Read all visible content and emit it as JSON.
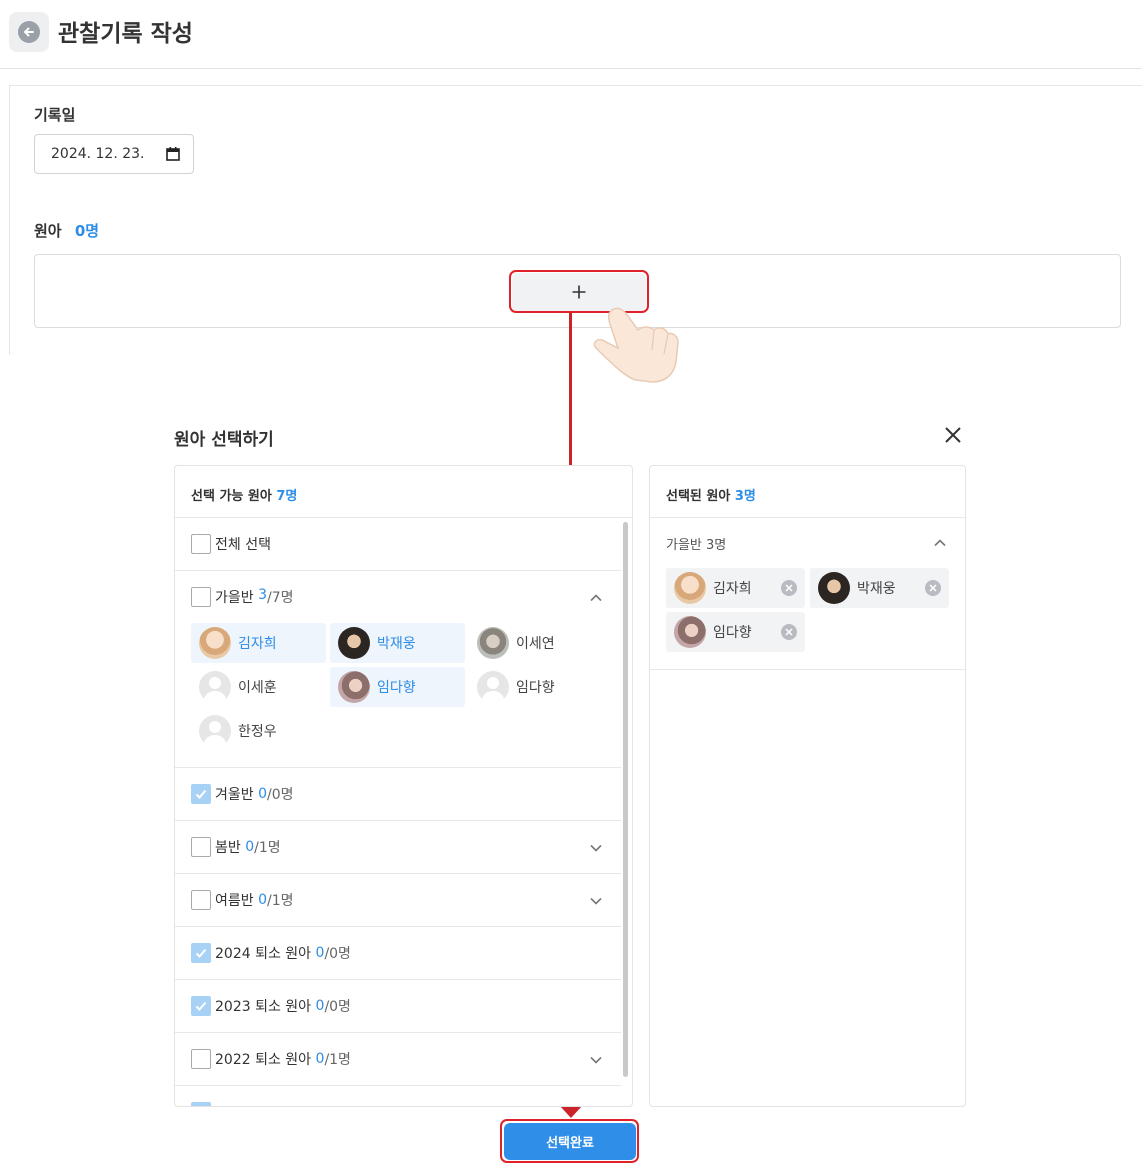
{
  "header": {
    "title": "관찰기록 작성"
  },
  "form": {
    "date_label": "기록일",
    "date_value": "2024. 12. 23.",
    "children_label": "원아",
    "children_count": "0명"
  },
  "modal": {
    "title": "원아 선택하기",
    "available": {
      "title": "선택 가능 원아",
      "count": "7명",
      "select_all": "전체 선택",
      "groups": [
        {
          "name": "가을반",
          "selected": "3",
          "total": "/7명"
        },
        {
          "name": "겨울반",
          "selected": "0",
          "total": "/0명"
        },
        {
          "name": "봄반",
          "selected": "0",
          "total": "/1명"
        },
        {
          "name": "여름반",
          "selected": "0",
          "total": "/1명"
        },
        {
          "name": "2024 퇴소 원아",
          "selected": "0",
          "total": "/0명"
        },
        {
          "name": "2023 퇴소 원아",
          "selected": "0",
          "total": "/0명"
        },
        {
          "name": "2022 퇴소 원아",
          "selected": "0",
          "total": "/1명"
        }
      ],
      "children": [
        {
          "name": "김자희",
          "selected": true
        },
        {
          "name": "박재웅",
          "selected": true
        },
        {
          "name": "이세연",
          "selected": false
        },
        {
          "name": "이세훈",
          "selected": false
        },
        {
          "name": "임다향",
          "selected": true
        },
        {
          "name": "임다향",
          "selected": false
        },
        {
          "name": "한정우",
          "selected": false
        }
      ]
    },
    "selected": {
      "title": "선택된 원아",
      "count": "3명",
      "group": {
        "name": "가을반",
        "count": "3명"
      },
      "children": [
        "김자희",
        "박재웅",
        "임다향"
      ]
    },
    "done_label": "선택완료"
  },
  "colors": {
    "accent": "#2e8de6",
    "highlight": "#e0222a",
    "button": "#2e8ee8"
  },
  "icons": [
    "back-arrow-icon",
    "calendar-icon",
    "plus-icon",
    "close-icon",
    "chevron-up-icon",
    "chevron-down-icon",
    "remove-chip-icon",
    "pointing-hand-icon"
  ]
}
